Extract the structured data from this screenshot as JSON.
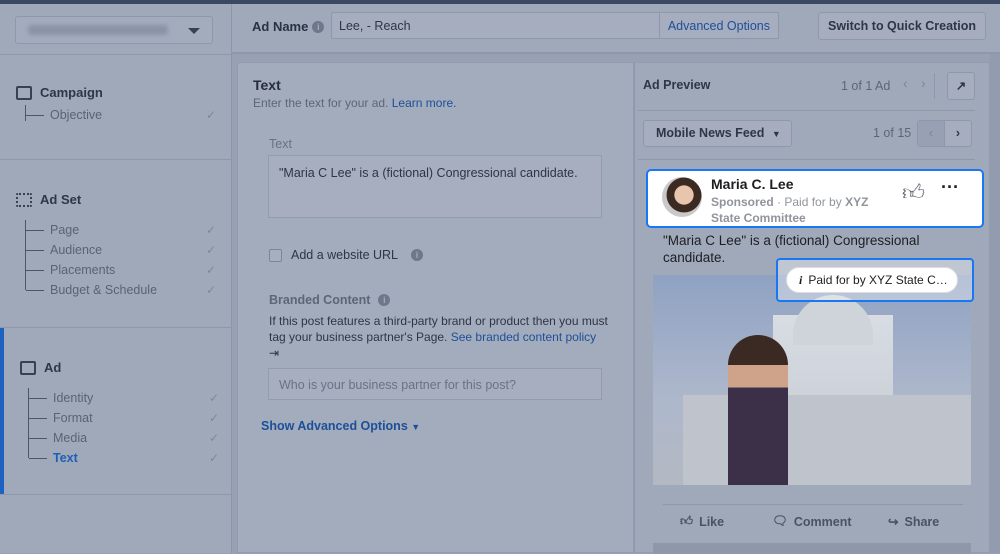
{
  "header": {
    "account_selector": "(blurred account name)",
    "ad_name_label": "Ad Name",
    "ad_name_value": "Lee, - Reach",
    "advanced_options": "Advanced Options",
    "switch_button": "Switch to Quick Creation"
  },
  "sidebar": {
    "campaign": {
      "label": "Campaign",
      "items": [
        {
          "label": "Objective"
        }
      ]
    },
    "adset": {
      "label": "Ad Set",
      "items": [
        {
          "label": "Page"
        },
        {
          "label": "Audience"
        },
        {
          "label": "Placements"
        },
        {
          "label": "Budget & Schedule"
        }
      ]
    },
    "ad": {
      "label": "Ad",
      "items": [
        {
          "label": "Identity"
        },
        {
          "label": "Format"
        },
        {
          "label": "Media"
        },
        {
          "label": "Text",
          "active": true
        }
      ]
    }
  },
  "main": {
    "title": "Text",
    "subtitle": "Enter the text for your ad.",
    "learn_more": "Learn more.",
    "text_label": "Text",
    "text_value": "\"Maria C Lee\" is a (fictional) Congressional candidate.",
    "website_checkbox": "Add a website URL",
    "branded_title": "Branded Content",
    "branded_desc": "If this post features a third-party brand or product then you must tag your business partner's Page.",
    "branded_link": "See branded content policy",
    "partner_placeholder": "Who is your business partner for this post?",
    "show_advanced": "Show Advanced Options"
  },
  "preview": {
    "title": "Ad Preview",
    "ad_count": "1 of 1 Ad",
    "placement": "Mobile News Feed",
    "placement_count": "1 of 15",
    "post": {
      "name": "Maria C. Lee",
      "sponsored": "Sponsored",
      "paid_for_prefix": "· Paid for by",
      "paid_for_bold": "XYZ",
      "paid_for_rest": "State Committee",
      "body": "\"Maria C Lee\" is a (fictional) Congressional candidate.",
      "tooltip": "Paid for by XYZ State C…",
      "like": "Like",
      "comment": "Comment",
      "share": "Share"
    }
  },
  "colors": {
    "accent": "#1877f2",
    "link": "#1d4f98",
    "overlay_bg": "#a0a9ba"
  }
}
